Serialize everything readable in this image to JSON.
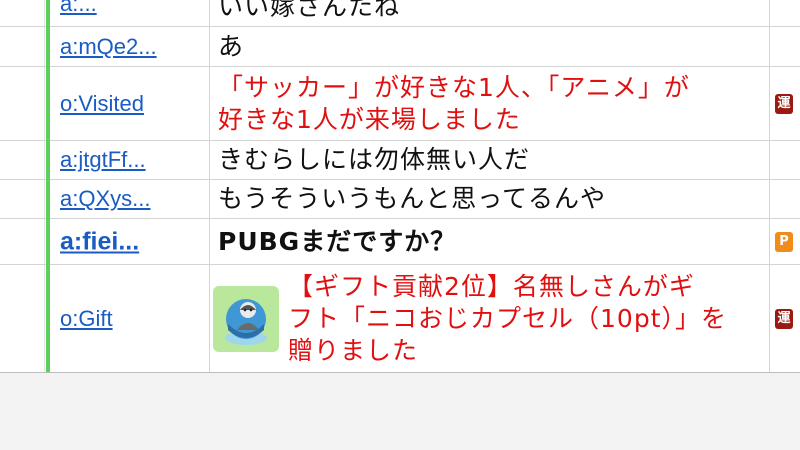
{
  "rows": [
    {
      "user": "a:...",
      "message": "いい嫁さんたね"
    },
    {
      "user": "a:mQe2...",
      "message": "あ"
    },
    {
      "user": "o:Visited",
      "message_line1": "「サッカー」が好きな1人、「アニメ」が",
      "message_line2": "好きな1人が来場しました",
      "badge": "運"
    },
    {
      "user": "a:jtgtFf...",
      "message": "きむらしには勿体無い人だ"
    },
    {
      "user": "a:QXys...",
      "message": "もうそういうもんと思ってるんや"
    },
    {
      "user": "a:fiei...",
      "message": "PUBGまだですか？",
      "badge": "P"
    },
    {
      "user": "o:Gift",
      "message_line1": "【ギフト貢献2位】名無しさんがギ",
      "message_line2": "フト「ニコおじカプセル（10pt）」を",
      "message_line3": "贈りました",
      "badge": "運",
      "gift_icon": "capsule-character-icon"
    }
  ],
  "colors": {
    "accent_green": "#5bd05b",
    "link_blue": "#1a5bc4",
    "system_red": "#e01010",
    "badge_dark_red": "#9a1a12",
    "badge_orange": "#ef8c1c"
  }
}
